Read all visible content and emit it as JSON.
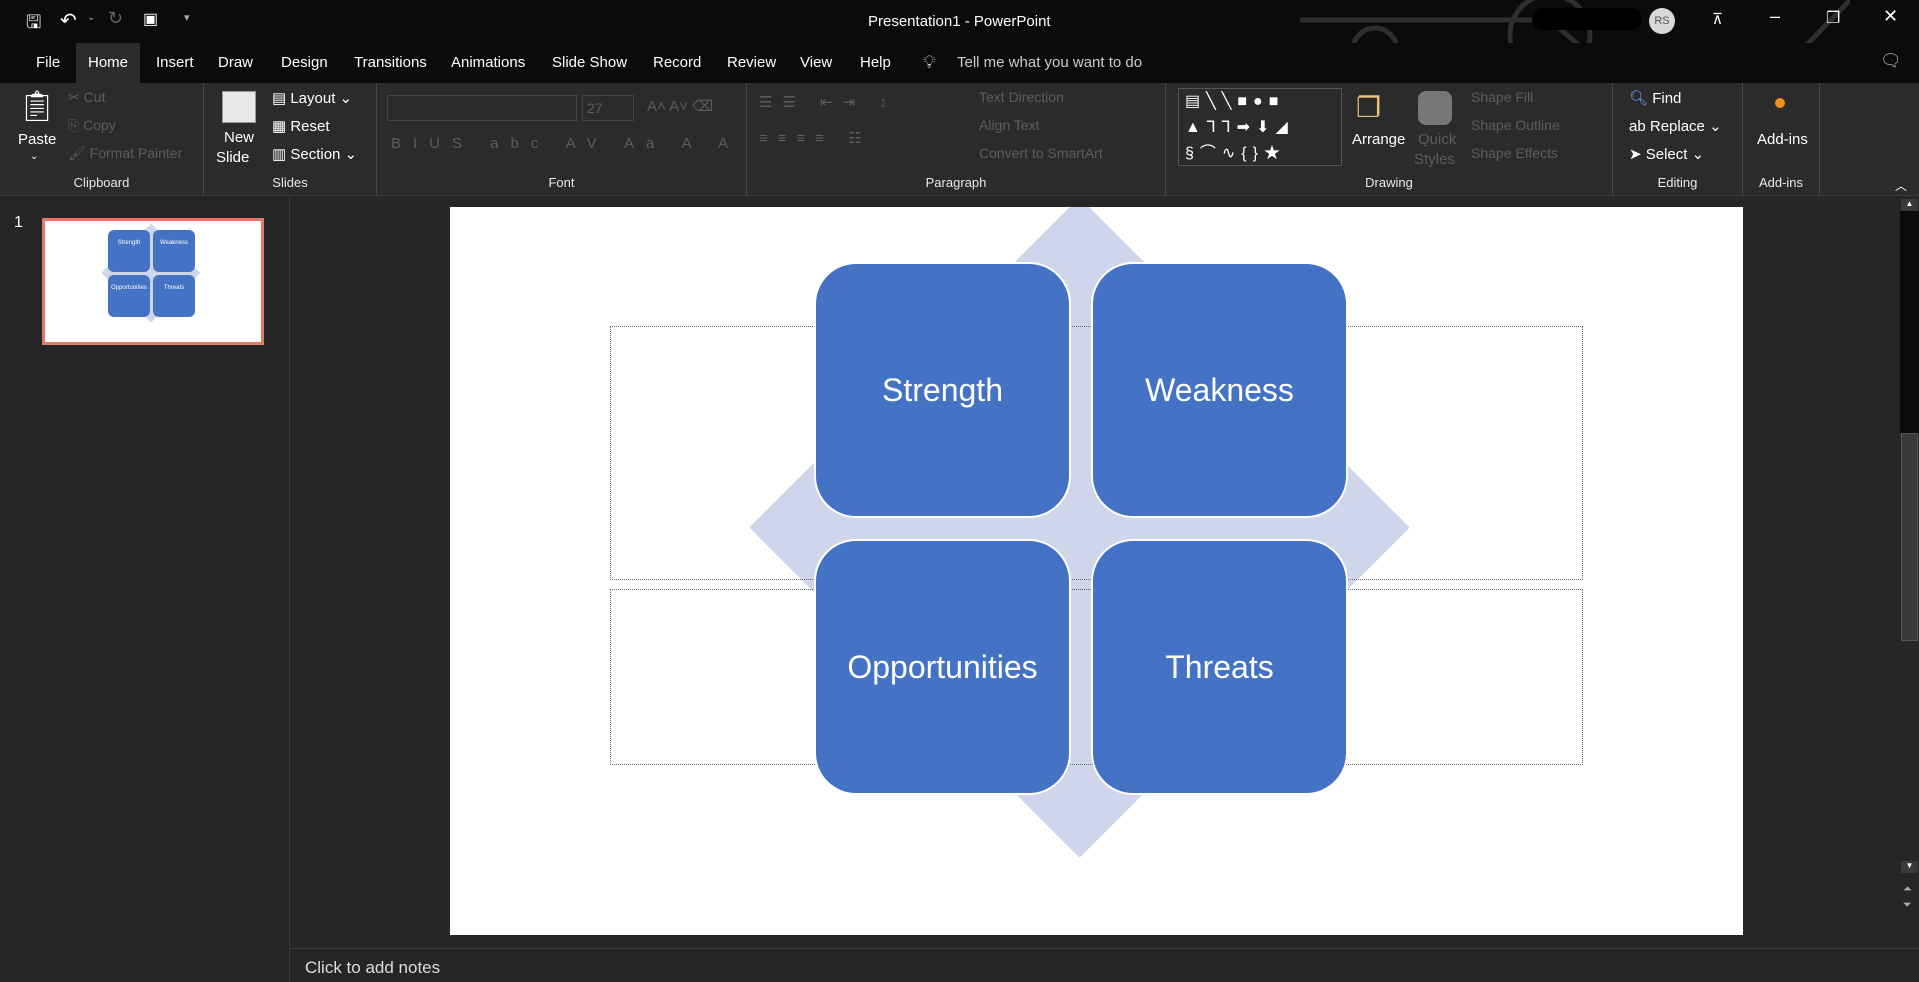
{
  "window": {
    "title": "Presentation1  -  PowerPoint",
    "user_initials": "RS"
  },
  "tabs": [
    "File",
    "Home",
    "Insert",
    "Draw",
    "Design",
    "Transitions",
    "Animations",
    "Slide Show",
    "Record",
    "Review",
    "View",
    "Help"
  ],
  "tell_me": "Tell me what you want to do",
  "ribbon": {
    "clipboard": {
      "label": "Clipboard",
      "paste": "Paste",
      "cut": "Cut",
      "copy": "Copy",
      "format_painter": "Format Painter"
    },
    "slides": {
      "label": "Slides",
      "new_slide": "New",
      "new_slide2": "Slide",
      "layout": "Layout",
      "reset": "Reset",
      "section": "Section"
    },
    "font": {
      "label": "Font",
      "size": "27"
    },
    "paragraph": {
      "label": "Paragraph",
      "text_direction": "Text Direction",
      "align_text": "Align Text",
      "convert": "Convert to SmartArt"
    },
    "drawing": {
      "label": "Drawing",
      "arrange": "Arrange",
      "quick_styles": "Quick",
      "quick_styles2": "Styles",
      "shape_fill": "Shape Fill",
      "shape_outline": "Shape Outline",
      "shape_effects": "Shape Effects"
    },
    "editing": {
      "label": "Editing",
      "find": "Find",
      "replace": "Replace",
      "select": "Select"
    },
    "addins": {
      "label": "Add-ins",
      "button": "Add-ins"
    }
  },
  "slide_panel": {
    "number": "1"
  },
  "slide": {
    "boxes": [
      "Strength",
      "Weakness",
      "Opportunities",
      "Threats"
    ]
  },
  "colors": {
    "box": "#4472c4",
    "diamond": "#cfd5ea",
    "thumb_border": "#e07a6a"
  },
  "notes": {
    "placeholder": "Click to add notes"
  }
}
